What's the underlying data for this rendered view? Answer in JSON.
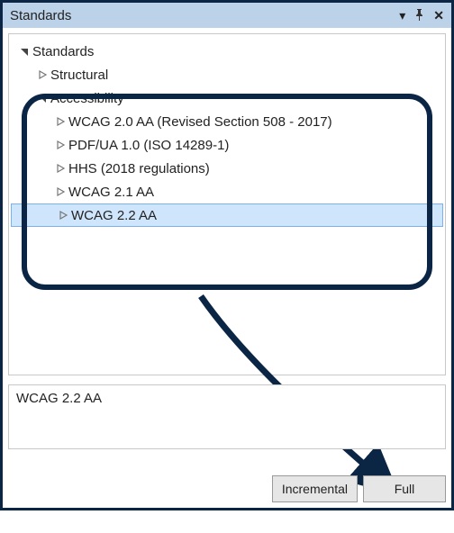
{
  "window": {
    "title": "Standards"
  },
  "tree": {
    "root": {
      "label": "Standards",
      "expanded": true
    },
    "structural": {
      "label": "Structural",
      "expanded": false
    },
    "accessibility": {
      "label": "Accessibility",
      "expanded": true
    },
    "items": [
      {
        "label": "WCAG 2.0 AA (Revised Section 508 - 2017)"
      },
      {
        "label": "PDF/UA 1.0 (ISO 14289-1)"
      },
      {
        "label": "HHS (2018 regulations)"
      },
      {
        "label": "WCAG 2.1 AA"
      },
      {
        "label": "WCAG 2.2 AA"
      }
    ],
    "selected_index": 4
  },
  "detail": {
    "text": "WCAG 2.2 AA"
  },
  "buttons": {
    "incremental": "Incremental",
    "full": "Full"
  },
  "icons": {
    "dropdown": "▼",
    "pin": "📌",
    "close": "✕",
    "expanded": "◢",
    "collapsed": "▷"
  }
}
